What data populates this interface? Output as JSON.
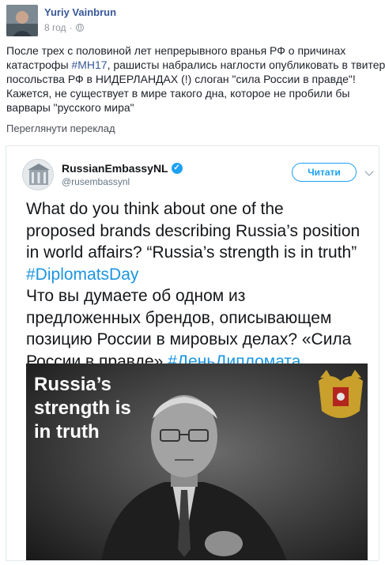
{
  "post": {
    "author": "Yuriy Vainbrun",
    "time": "8 год",
    "separator": "·",
    "text_lines": [
      "После трех с половиной лет непрерывного вранья РФ о причинах",
      "катастрофы ",
      "#MH17",
      ", рашисты набрались наглости опубликовать в твитере",
      "посольства РФ в НИДЕРЛАНДАХ (!) слоган \"сила России в правде\"!",
      "Кажется, не существует в мире такого дна, которое не пробили бы",
      "варвары \"русского мира\""
    ],
    "see_translation": "Переглянути переклад"
  },
  "tweet": {
    "name": "RussianEmbassyNL",
    "handle": "@rusembassynl",
    "follow_label": "Читати",
    "text": {
      "l1": "What do you think about one of the",
      "l2": "proposed brands describing Russia’s position",
      "l3": "in world affairs? “Russia’s strength is in truth”",
      "l4": "#DiplomatsDay",
      "l5": "Что вы думаете об одном из",
      "l6": "предложенных брендов, описывающем",
      "l7": "позицию России в мировых делах? «Сила",
      "l8a": "России в правде» ",
      "l8b": "#ДеньДипломата"
    },
    "image": {
      "slogan_lines": [
        "Russia’s",
        "strength is",
        "in truth"
      ]
    }
  },
  "icons": {
    "privacy": "globe-icon",
    "verified": "verified-badge-icon",
    "menu": "chevron-down-icon",
    "emblem": "double-headed-eagle-emblem"
  },
  "colors": {
    "fb_link": "#385898",
    "twitter_blue": "#1da1f2",
    "hashtag_fb": "#365899",
    "hashtag_tw": "#1b95e0"
  }
}
